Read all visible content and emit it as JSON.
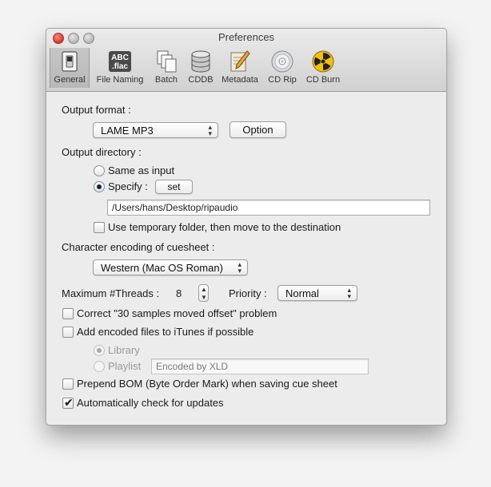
{
  "window": {
    "title": "Preferences"
  },
  "toolbar": [
    {
      "label": "General",
      "icon": "switch-icon",
      "selected": true
    },
    {
      "label": "File Naming",
      "icon": "abc-flac-icon",
      "icon_text_top": "ABC",
      "icon_text_bottom": ".flac"
    },
    {
      "label": "Batch",
      "icon": "stacked-files-icon"
    },
    {
      "label": "CDDB",
      "icon": "database-icon"
    },
    {
      "label": "Metadata",
      "icon": "pencil-paper-icon"
    },
    {
      "label": "CD Rip",
      "icon": "disc-icon"
    },
    {
      "label": "CD Burn",
      "icon": "radiation-icon"
    }
  ],
  "general": {
    "output_format_label": "Output format :",
    "output_format_value": "LAME MP3",
    "option_button": "Option",
    "output_directory_label": "Output directory :",
    "same_as_input_label": "Same as input",
    "specify_label": "Specify :",
    "set_button": "set",
    "directory_path": "/Users/hans/Desktop/ripaudio",
    "temp_folder_label": "Use temporary folder, then move to the destination",
    "cuesheet_encoding_label": "Character encoding of cuesheet :",
    "cuesheet_encoding_value": "Western (Mac OS Roman)",
    "threads_label": "Maximum #Threads :",
    "threads_value": "8",
    "priority_label": "Priority :",
    "priority_value": "Normal",
    "correct_offset_label": "Correct \"30 samples moved offset\" problem",
    "itunes_label": "Add encoded files to iTunes if possible",
    "library_label": "Library",
    "playlist_label": "Playlist",
    "playlist_placeholder": "Encoded by XLD",
    "bom_label": "Prepend BOM (Byte Order Mark) when saving cue sheet",
    "updates_label": "Automatically check for updates"
  },
  "state": {
    "output_directory_mode": "specify",
    "use_temp_folder": false,
    "correct_offset": false,
    "add_to_itunes": false,
    "itunes_target": "library",
    "prepend_bom": false,
    "auto_check_updates": true
  },
  "colors": {
    "radiation_yellow": "#f2c012",
    "accent_blue": "#6f8db4"
  }
}
